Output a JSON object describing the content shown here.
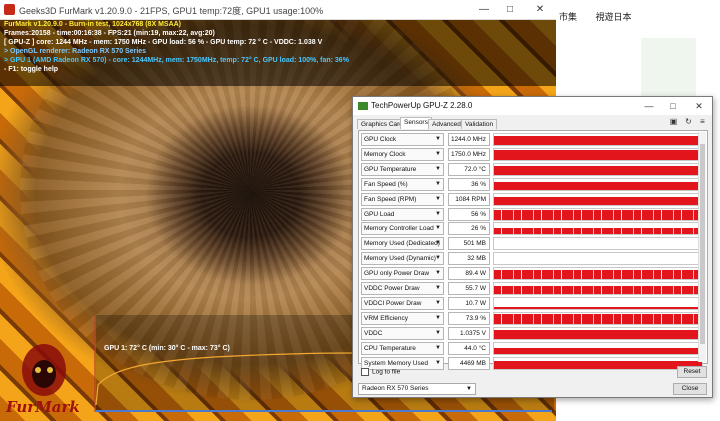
{
  "background_browser": {
    "tabs": [
      "市集",
      "視遊日本"
    ]
  },
  "furmark": {
    "window_title": "Geeks3D FurMark v1.20.9.0 - 21FPS, GPU1 temp:72度, GPU1 usage:100%",
    "info_lines": [
      {
        "text": "FurMark v1.20.9.0 - Burn-in test, 1024x768 (8X MSAA)",
        "color": "yellow"
      },
      {
        "text": "Frames:20158 - time:00:16:38 - FPS:21 (min:19, max:22, avg:20)",
        "color": "white"
      },
      {
        "text": "[ GPU-Z ] core: 1244 MHz - mem: 1750 MHz - GPU load: 56 % - GPU temp: 72 ° C - VDDC: 1.038 V",
        "color": "white"
      },
      {
        "text": "> OpenGL renderer: Radeon RX 570 Series",
        "color": "blue"
      },
      {
        "text": "> GPU 1 (AMD Radeon RX 570) - core: 1244MHz, mem: 1750MHz, temp: 72° C, GPU load: 100%, fan: 36%",
        "color": "cyan"
      },
      {
        "text": "- F1: toggle help",
        "color": "white"
      }
    ],
    "graph_label": "GPU 1: 72° C (min: 30° C - max: 73° C)",
    "logo_text": "FurMark"
  },
  "gpuz": {
    "window_title": "TechPowerUp GPU-Z 2.28.0",
    "tabs": [
      "Graphics Card",
      "Sensors",
      "Advanced",
      "Validation"
    ],
    "active_tab": "Sensors",
    "sensors": [
      {
        "name": "GPU Clock",
        "value": "1244.0 MHz",
        "level": 0.85,
        "spiky": false
      },
      {
        "name": "Memory Clock",
        "value": "1750.0 MHz",
        "level": 0.9,
        "spiky": false
      },
      {
        "name": "GPU Temperature",
        "value": "72.0 °C",
        "level": 0.82,
        "spiky": false
      },
      {
        "name": "Fan Speed (%)",
        "value": "36 %",
        "level": 0.7,
        "spiky": false
      },
      {
        "name": "Fan Speed (RPM)",
        "value": "1084 RPM",
        "level": 0.72,
        "spiky": false
      },
      {
        "name": "GPU Load",
        "value": "56 %",
        "level": 0.9,
        "spiky": true
      },
      {
        "name": "Memory Controller Load",
        "value": "26 %",
        "level": 0.6,
        "spiky": true
      },
      {
        "name": "Memory Used (Dedicated)",
        "value": "501 MB",
        "level": 0.0,
        "spiky": false
      },
      {
        "name": "Memory Used (Dynamic)",
        "value": "32 MB",
        "level": 0.0,
        "spiky": false
      },
      {
        "name": "GPU only Power Draw",
        "value": "89.4 W",
        "level": 0.8,
        "spiky": true
      },
      {
        "name": "VDDC Power Draw",
        "value": "55.7 W",
        "level": 0.75,
        "spiky": true
      },
      {
        "name": "VDDCI Power Draw",
        "value": "10.7 W",
        "level": 0.15,
        "spiky": false
      },
      {
        "name": "VRM Efficiency",
        "value": "73.9 %",
        "level": 0.85,
        "spiky": true
      },
      {
        "name": "VDDC",
        "value": "1.0375 V",
        "level": 0.8,
        "spiky": false
      },
      {
        "name": "CPU Temperature",
        "value": "44.0 °C",
        "level": 0.55,
        "spiky": false
      },
      {
        "name": "System Memory Used",
        "value": "4469 MB",
        "level": 0.65,
        "spiky": false
      }
    ],
    "log_label": "Log to file",
    "reset_label": "Reset",
    "device_select": "Radeon RX 570 Series",
    "close_label": "Close",
    "graph_color": "#e2151d"
  }
}
